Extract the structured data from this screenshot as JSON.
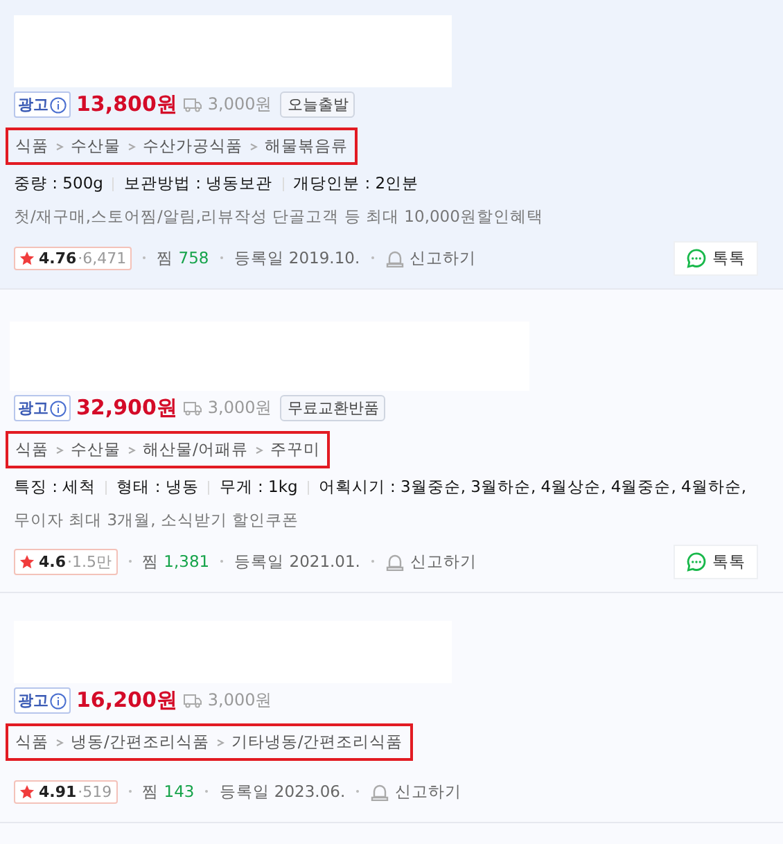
{
  "products": [
    {
      "ad_label": "광고",
      "price": "13,800원",
      "shipping": "3,000원",
      "tag": "오늘출발",
      "breadcrumb_highlighted": true,
      "breadcrumb": [
        "식품",
        "수산물",
        "수산가공식품",
        "해물볶음류"
      ],
      "specs": [
        "중량 : 500g",
        "보관방법 : 냉동보관",
        "개당인분 : 2인분"
      ],
      "benefit": "첫/재구매,스토어찜/알림,리뷰작성 단골고객 등 최대 10,000원할인혜택",
      "rating": "4.76",
      "review_count": "·6,471",
      "wish_label": "찜",
      "wish_count": "758",
      "registered": "등록일 2019.10.",
      "report": "신고하기",
      "talk": "톡톡"
    },
    {
      "ad_label": "광고",
      "price": "32,900원",
      "shipping": "3,000원",
      "tag": "무료교환반품",
      "breadcrumb_highlighted": true,
      "breadcrumb": [
        "식품",
        "수산물",
        "해산물/어패류",
        "주꾸미"
      ],
      "specs": [
        "특징 : 세척",
        "형태 : 냉동",
        "무게 : 1kg",
        "어획시기 : 3월중순, 3월하순, 4월상순, 4월중순, 4월하순,"
      ],
      "benefit": "무이자 최대 3개월, 소식받기 할인쿠폰",
      "rating": "4.6",
      "review_count": "·1.5만",
      "wish_label": "찜",
      "wish_count": "1,381",
      "registered": "등록일 2021.01.",
      "report": "신고하기",
      "talk": "톡톡"
    },
    {
      "ad_label": "광고",
      "price": "16,200원",
      "shipping": "3,000원",
      "breadcrumb_highlighted": true,
      "breadcrumb": [
        "식품",
        "냉동/간편조리식품",
        "기타냉동/간편조리식품"
      ],
      "rating": "4.91",
      "review_count": "·519",
      "wish_label": "찜",
      "wish_count": "143",
      "registered": "등록일 2023.06.",
      "report": "신고하기"
    }
  ]
}
